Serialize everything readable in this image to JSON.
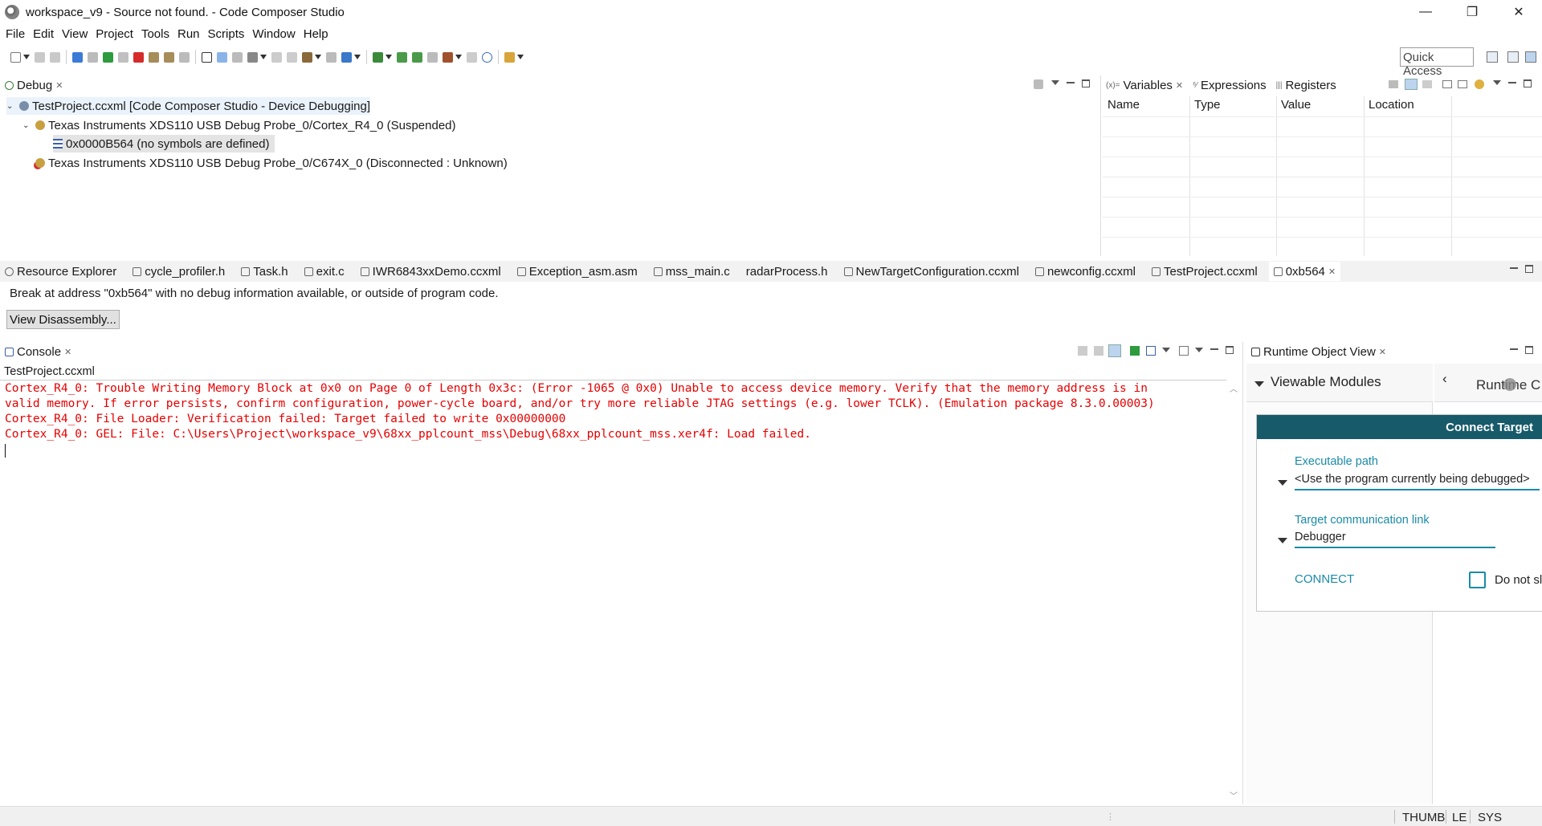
{
  "window": {
    "title": "workspace_v9 - Source not found. - Code Composer Studio",
    "minimize_glyph": "—",
    "restore_glyph": "❐",
    "close_glyph": "✕"
  },
  "menu": [
    "File",
    "Edit",
    "View",
    "Project",
    "Tools",
    "Run",
    "Scripts",
    "Window",
    "Help"
  ],
  "quick_access": {
    "label": "Quick Access"
  },
  "debug_view": {
    "tab_label": "Debug",
    "tree": [
      {
        "label": "TestProject.ccxml [Code Composer Studio - Device Debugging]"
      },
      {
        "label": "Texas Instruments XDS110 USB Debug Probe_0/Cortex_R4_0 (Suspended)"
      },
      {
        "label": "0x0000B564  (no symbols are defined)"
      },
      {
        "label": "Texas Instruments XDS110 USB Debug Probe_0/C674X_0 (Disconnected : Unknown)"
      }
    ]
  },
  "variables_view": {
    "tabs": [
      {
        "label": "Variables"
      },
      {
        "label": "Expressions"
      },
      {
        "label": "Registers"
      }
    ],
    "columns": [
      "Name",
      "Type",
      "Value",
      "Location"
    ]
  },
  "editor": {
    "tabs": [
      {
        "label": "Resource Explorer"
      },
      {
        "label": "cycle_profiler.h"
      },
      {
        "label": "Task.h"
      },
      {
        "label": "exit.c"
      },
      {
        "label": "IWR6843xxDemo.ccxml"
      },
      {
        "label": "Exception_asm.asm"
      },
      {
        "label": "mss_main.c"
      },
      {
        "label": "radarProcess.h"
      },
      {
        "label": "NewTargetConfiguration.ccxml"
      },
      {
        "label": "newconfig.ccxml"
      },
      {
        "label": "TestProject.ccxml"
      },
      {
        "label": "0xb564"
      }
    ],
    "message": "Break at address \"0xb564\" with no debug information available, or outside of program code.",
    "view_disassembly_label": "View Disassembly..."
  },
  "console": {
    "tab_label": "Console",
    "subtitle": "TestProject.ccxml",
    "lines": [
      "Cortex_R4_0: Trouble Writing Memory Block at 0x0 on Page 0 of Length 0x3c: (Error -1065 @ 0x0) Unable to access device memory. Verify that the memory address is in",
      "valid memory. If error persists, confirm configuration, power-cycle board, and/or try more reliable JTAG settings (e.g. lower TCLK). (Emulation package 8.3.0.00003)",
      "Cortex_R4_0: File Loader: Verification failed: Target failed to write 0x00000000",
      "Cortex_R4_0: GEL: File: C:\\Users\\Project\\workspace_v9\\68xx_pplcount_mss\\Debug\\68xx_pplcount_mss.xer4f: Load failed."
    ],
    "error_color": "#e60000"
  },
  "runtime_object_view": {
    "tab_label": "Runtime Object View",
    "viewable_modules": "Viewable Modules",
    "right_title": "Runtime C",
    "connect_target_header": "Connect Target",
    "executable_path_label": "Executable path",
    "executable_path_value": "<Use the program currently being debugged>",
    "comm_link_label": "Target communication link",
    "comm_link_value": "Debugger",
    "connect_label": "CONNECT",
    "checkbox_label": "Do not sl",
    "header_color": "#175a6a",
    "accent_color": "#1a8aa8"
  },
  "status_bar": {
    "segments": [
      "THUMB",
      "LE",
      "SYS"
    ]
  }
}
